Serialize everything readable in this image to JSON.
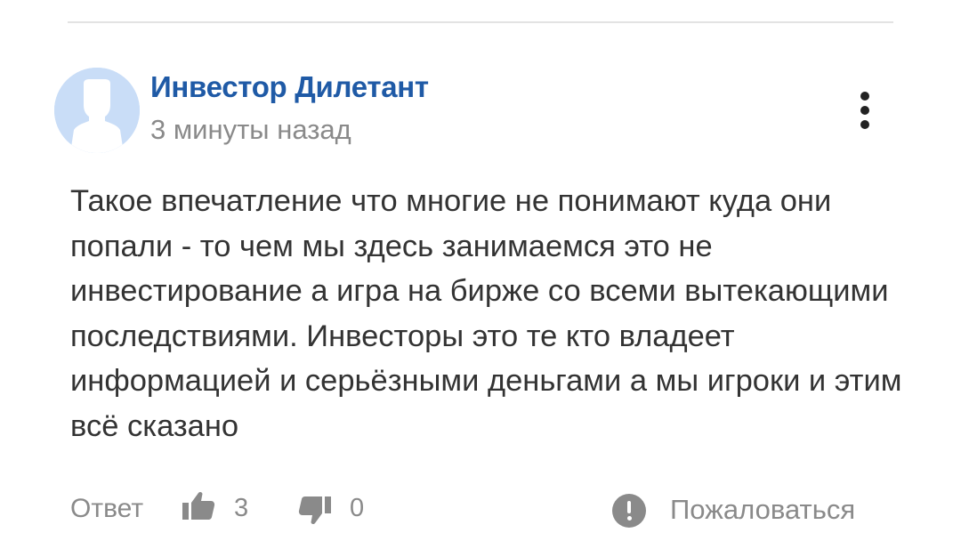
{
  "comment": {
    "author": "Инвестор Дилетант",
    "time": "3 минуты назад",
    "text": "Такое впечатление что многие не понимают куда они попали - то чем мы здесь занимаемся это не инвестирование а игра на бирже со всеми вытекающими последствиями. Инвесторы это те кто владеет информацией и серьёзными деньгами а мы игроки и этим всё сказано",
    "avatar_icon": "default-user-avatar",
    "menu_icon": "vertical-dots-icon"
  },
  "actions": {
    "reply_label": "Ответ",
    "likes": "3",
    "dislikes": "0",
    "report_label": "Пожаловаться",
    "like_icon": "thumbs-up-icon",
    "dislike_icon": "thumbs-down-icon",
    "report_icon": "exclamation-circle-icon"
  },
  "colors": {
    "author": "#1f5aa6",
    "muted": "#8a8a8a",
    "text": "#333333",
    "avatar_bg": "#c9ddf7"
  }
}
